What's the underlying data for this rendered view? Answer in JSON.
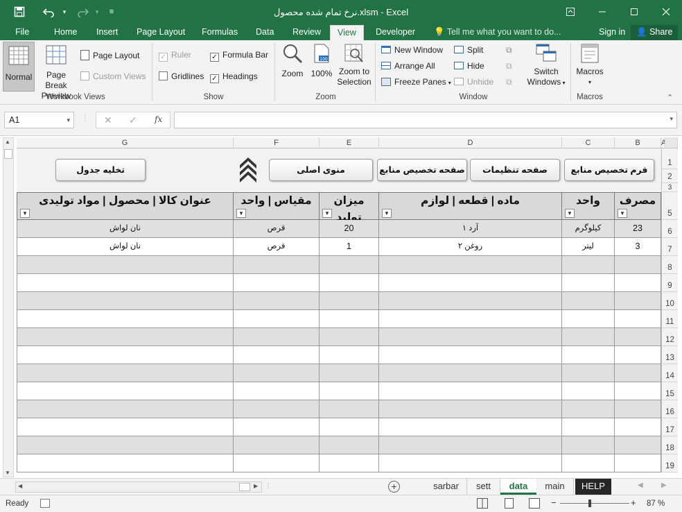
{
  "window": {
    "title": "نرخ تمام شده محصول.xlsm - Excel",
    "sign_in": "Sign in",
    "share": "Share"
  },
  "ribbon_tabs": [
    "File",
    "Home",
    "Insert",
    "Page Layout",
    "Formulas",
    "Data",
    "Review",
    "View",
    "Developer"
  ],
  "active_tab": "View",
  "tell_me": "Tell me what you want to do...",
  "ribbon": {
    "workbook_views": {
      "label": "Workbook Views",
      "normal": "Normal",
      "page_break_1": "Page Break",
      "page_break_2": "Preview",
      "page_layout": "Page Layout",
      "custom_views": "Custom Views"
    },
    "show": {
      "label": "Show",
      "ruler": "Ruler",
      "formula_bar": "Formula Bar",
      "gridlines": "Gridlines",
      "headings": "Headings"
    },
    "zoom": {
      "label": "Zoom",
      "zoom": "Zoom",
      "hundred": "100%",
      "zoom_sel_1": "Zoom to",
      "zoom_sel_2": "Selection"
    },
    "window_grp": {
      "label": "Window",
      "new_window": "New Window",
      "arrange_all": "Arrange All",
      "freeze_panes": "Freeze Panes",
      "split": "Split",
      "hide": "Hide",
      "unhide": "Unhide",
      "switch_1": "Switch",
      "switch_2": "Windows"
    },
    "macros": {
      "label": "Macros",
      "macros": "Macros"
    }
  },
  "formula_bar": {
    "name_box": "A1",
    "fx": "fx",
    "value": ""
  },
  "columns": [
    "G",
    "F",
    "E",
    "D",
    "C",
    "B",
    "A"
  ],
  "rows": [
    "1",
    "2",
    "3",
    "5",
    "6",
    "7",
    "8",
    "9",
    "10",
    "11",
    "12",
    "13",
    "14",
    "15",
    "16",
    "17",
    "18",
    "19"
  ],
  "buttons": {
    "clear_table": "تخلیه جدول",
    "main_menu": "منوی اصلی",
    "allocation_page": "صفحه تخصیص منابع",
    "settings_page": "صفحه تنظیمات",
    "allocation_form": "فرم تخصیص منابع"
  },
  "table": {
    "headers": {
      "g": "عنوان کالا | محصول | مواد تولیدی",
      "f": "مقیاس | واحد",
      "e": "میزان تولید",
      "d": "ماده | قطعه | لوازم",
      "c": "واحد",
      "b": "مصرف"
    },
    "rows": [
      {
        "g": "نان لواش",
        "f": "قرص",
        "e": "20",
        "d": "آرد ۱",
        "c": "کیلوگرم",
        "b": "23"
      },
      {
        "g": "نان لواش",
        "f": "قرص",
        "e": "1",
        "d": "روغن ۲",
        "c": "لیتر",
        "b": "3"
      }
    ]
  },
  "sheet_tabs": [
    "sarbar",
    "sett",
    "data",
    "main",
    "HELP"
  ],
  "active_sheet": "data",
  "status": {
    "ready": "Ready",
    "zoom": "87 %"
  },
  "colors": {
    "excel_green": "#217346",
    "header_gray": "#d9d9d9",
    "band_gray": "#e0e0e0"
  }
}
